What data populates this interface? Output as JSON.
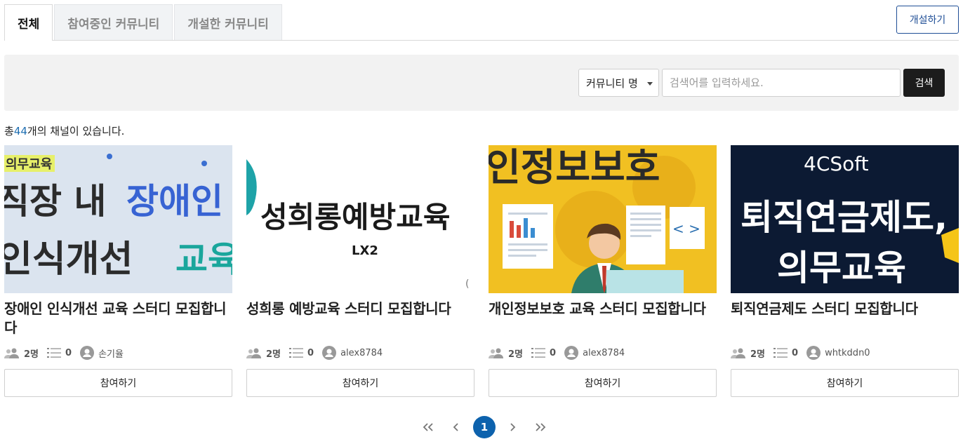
{
  "tabs": [
    {
      "label": "전체",
      "active": true
    },
    {
      "label": "참여중인 커뮤니티",
      "active": false
    },
    {
      "label": "개설한 커뮤니티",
      "active": false
    }
  ],
  "create_button": "개설하기",
  "search": {
    "select_value": "커뮤니티 명",
    "placeholder": "검색어를 입력하세요.",
    "button": "검색"
  },
  "count": {
    "prefix": "총",
    "number": "44",
    "suffix": "개의 채널이 있습니다."
  },
  "cards": [
    {
      "image_text": [
        "의무교육",
        "직장 내",
        "장애인",
        "인식개선",
        "교육"
      ],
      "title": "장애인 인식개선 교육 스터디 모집합니다",
      "members": "2명",
      "posts": "0",
      "owner": "손기율",
      "join": "참여하기"
    },
    {
      "image_text": [
        "성희롱예방교육",
        "LX2"
      ],
      "title": "성희롱 예방교육 스터디 모집합니다",
      "members": "2명",
      "posts": "0",
      "owner": "alex8784",
      "join": "참여하기"
    },
    {
      "image_text": [
        "인정보보호"
      ],
      "title": "개인정보보호 교육 스터디 모집합니다",
      "members": "2명",
      "posts": "0",
      "owner": "alex8784",
      "join": "참여하기"
    },
    {
      "image_text": [
        "4CSoft",
        "퇴직연금제도,",
        "의무교육"
      ],
      "title": "퇴직연금제도 스터디 모집합니다",
      "members": "2명",
      "posts": "0",
      "owner": "whtkddn0",
      "join": "참여하기"
    }
  ],
  "pagination": {
    "current": "1"
  },
  "colors": {
    "primary": "#0d62ad",
    "accent_blue": "#1f6fb2",
    "dark_button": "#1c1c1c"
  }
}
